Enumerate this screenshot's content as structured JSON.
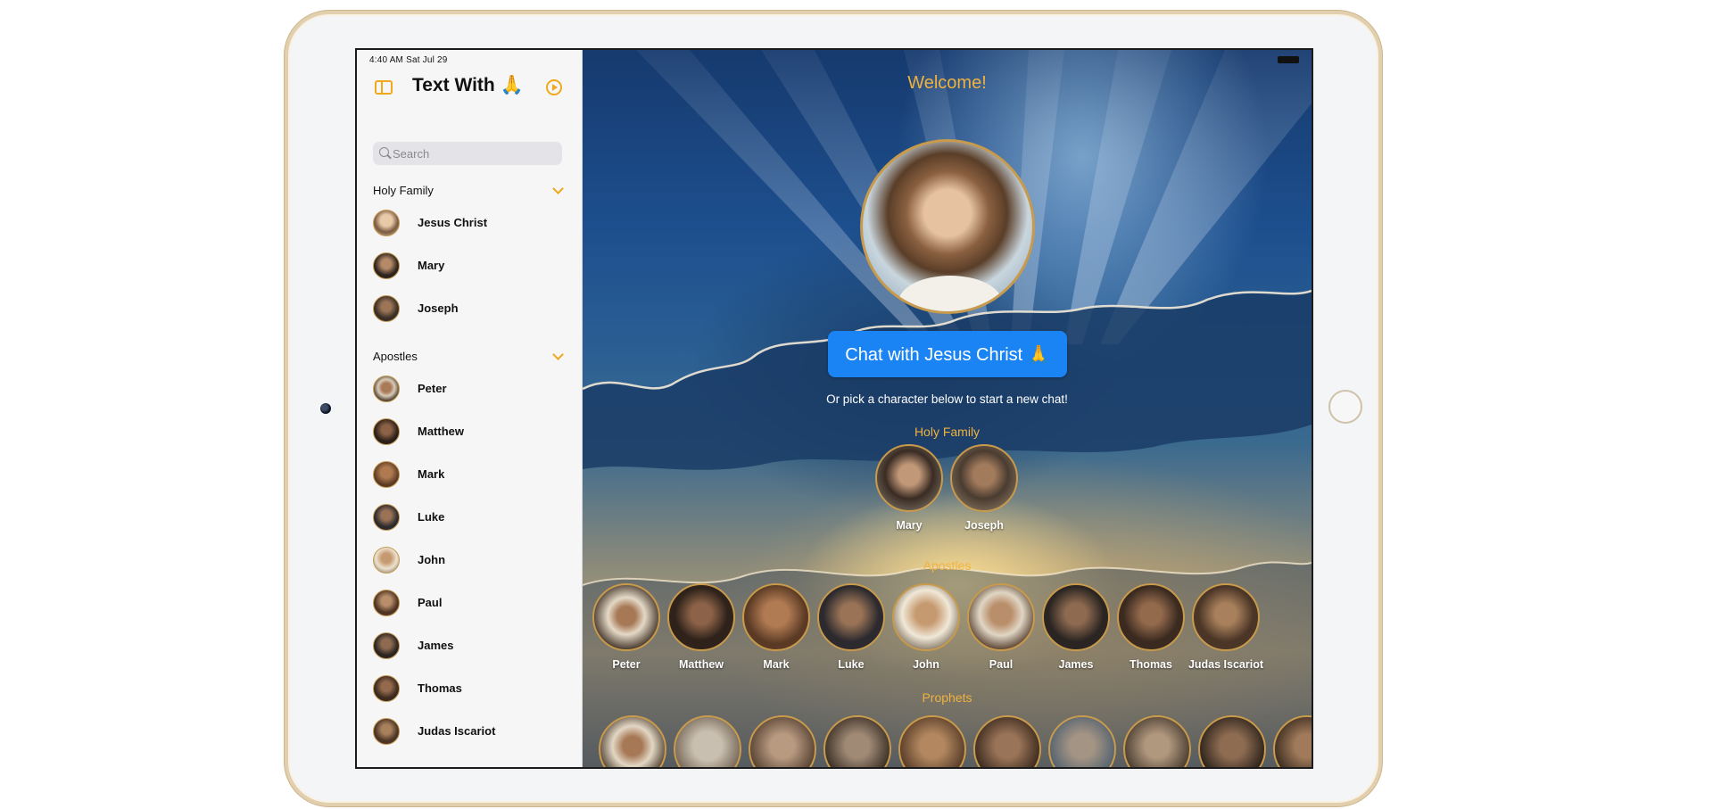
{
  "device": {
    "status_time": "4:40 AM   Sat Jul 29"
  },
  "sidebar": {
    "title": "Text With 🙏",
    "search_placeholder": "Search",
    "sections": [
      {
        "title": "Holy Family",
        "items": [
          "Jesus Christ",
          "Mary",
          "Joseph"
        ]
      },
      {
        "title": "Apostles",
        "items": [
          "Peter",
          "Matthew",
          "Mark",
          "Luke",
          "John",
          "Paul",
          "James",
          "Thomas",
          "Judas Iscariot"
        ]
      }
    ]
  },
  "main": {
    "welcome": "Welcome!",
    "chat_button": "Chat with Jesus Christ 🙏",
    "subtitle": "Or pick a character below to start a new chat!",
    "holy_family": {
      "title": "Holy Family",
      "characters": [
        "Mary",
        "Joseph"
      ]
    },
    "apostles": {
      "title": "Apostles",
      "characters": [
        "Peter",
        "Matthew",
        "Mark",
        "Luke",
        "John",
        "Paul",
        "James",
        "Thomas",
        "Judas Iscariot"
      ]
    },
    "prophets": {
      "title": "Prophets"
    }
  },
  "colors": {
    "accent": "#f0a81c",
    "gold_text": "#f0b23e",
    "chat_button": "#1a84f5",
    "portrait_border": "#c89a4c"
  },
  "icons": [
    "sidebar-toggle-icon",
    "compose-icon",
    "search-icon",
    "chevron-down-icon"
  ]
}
